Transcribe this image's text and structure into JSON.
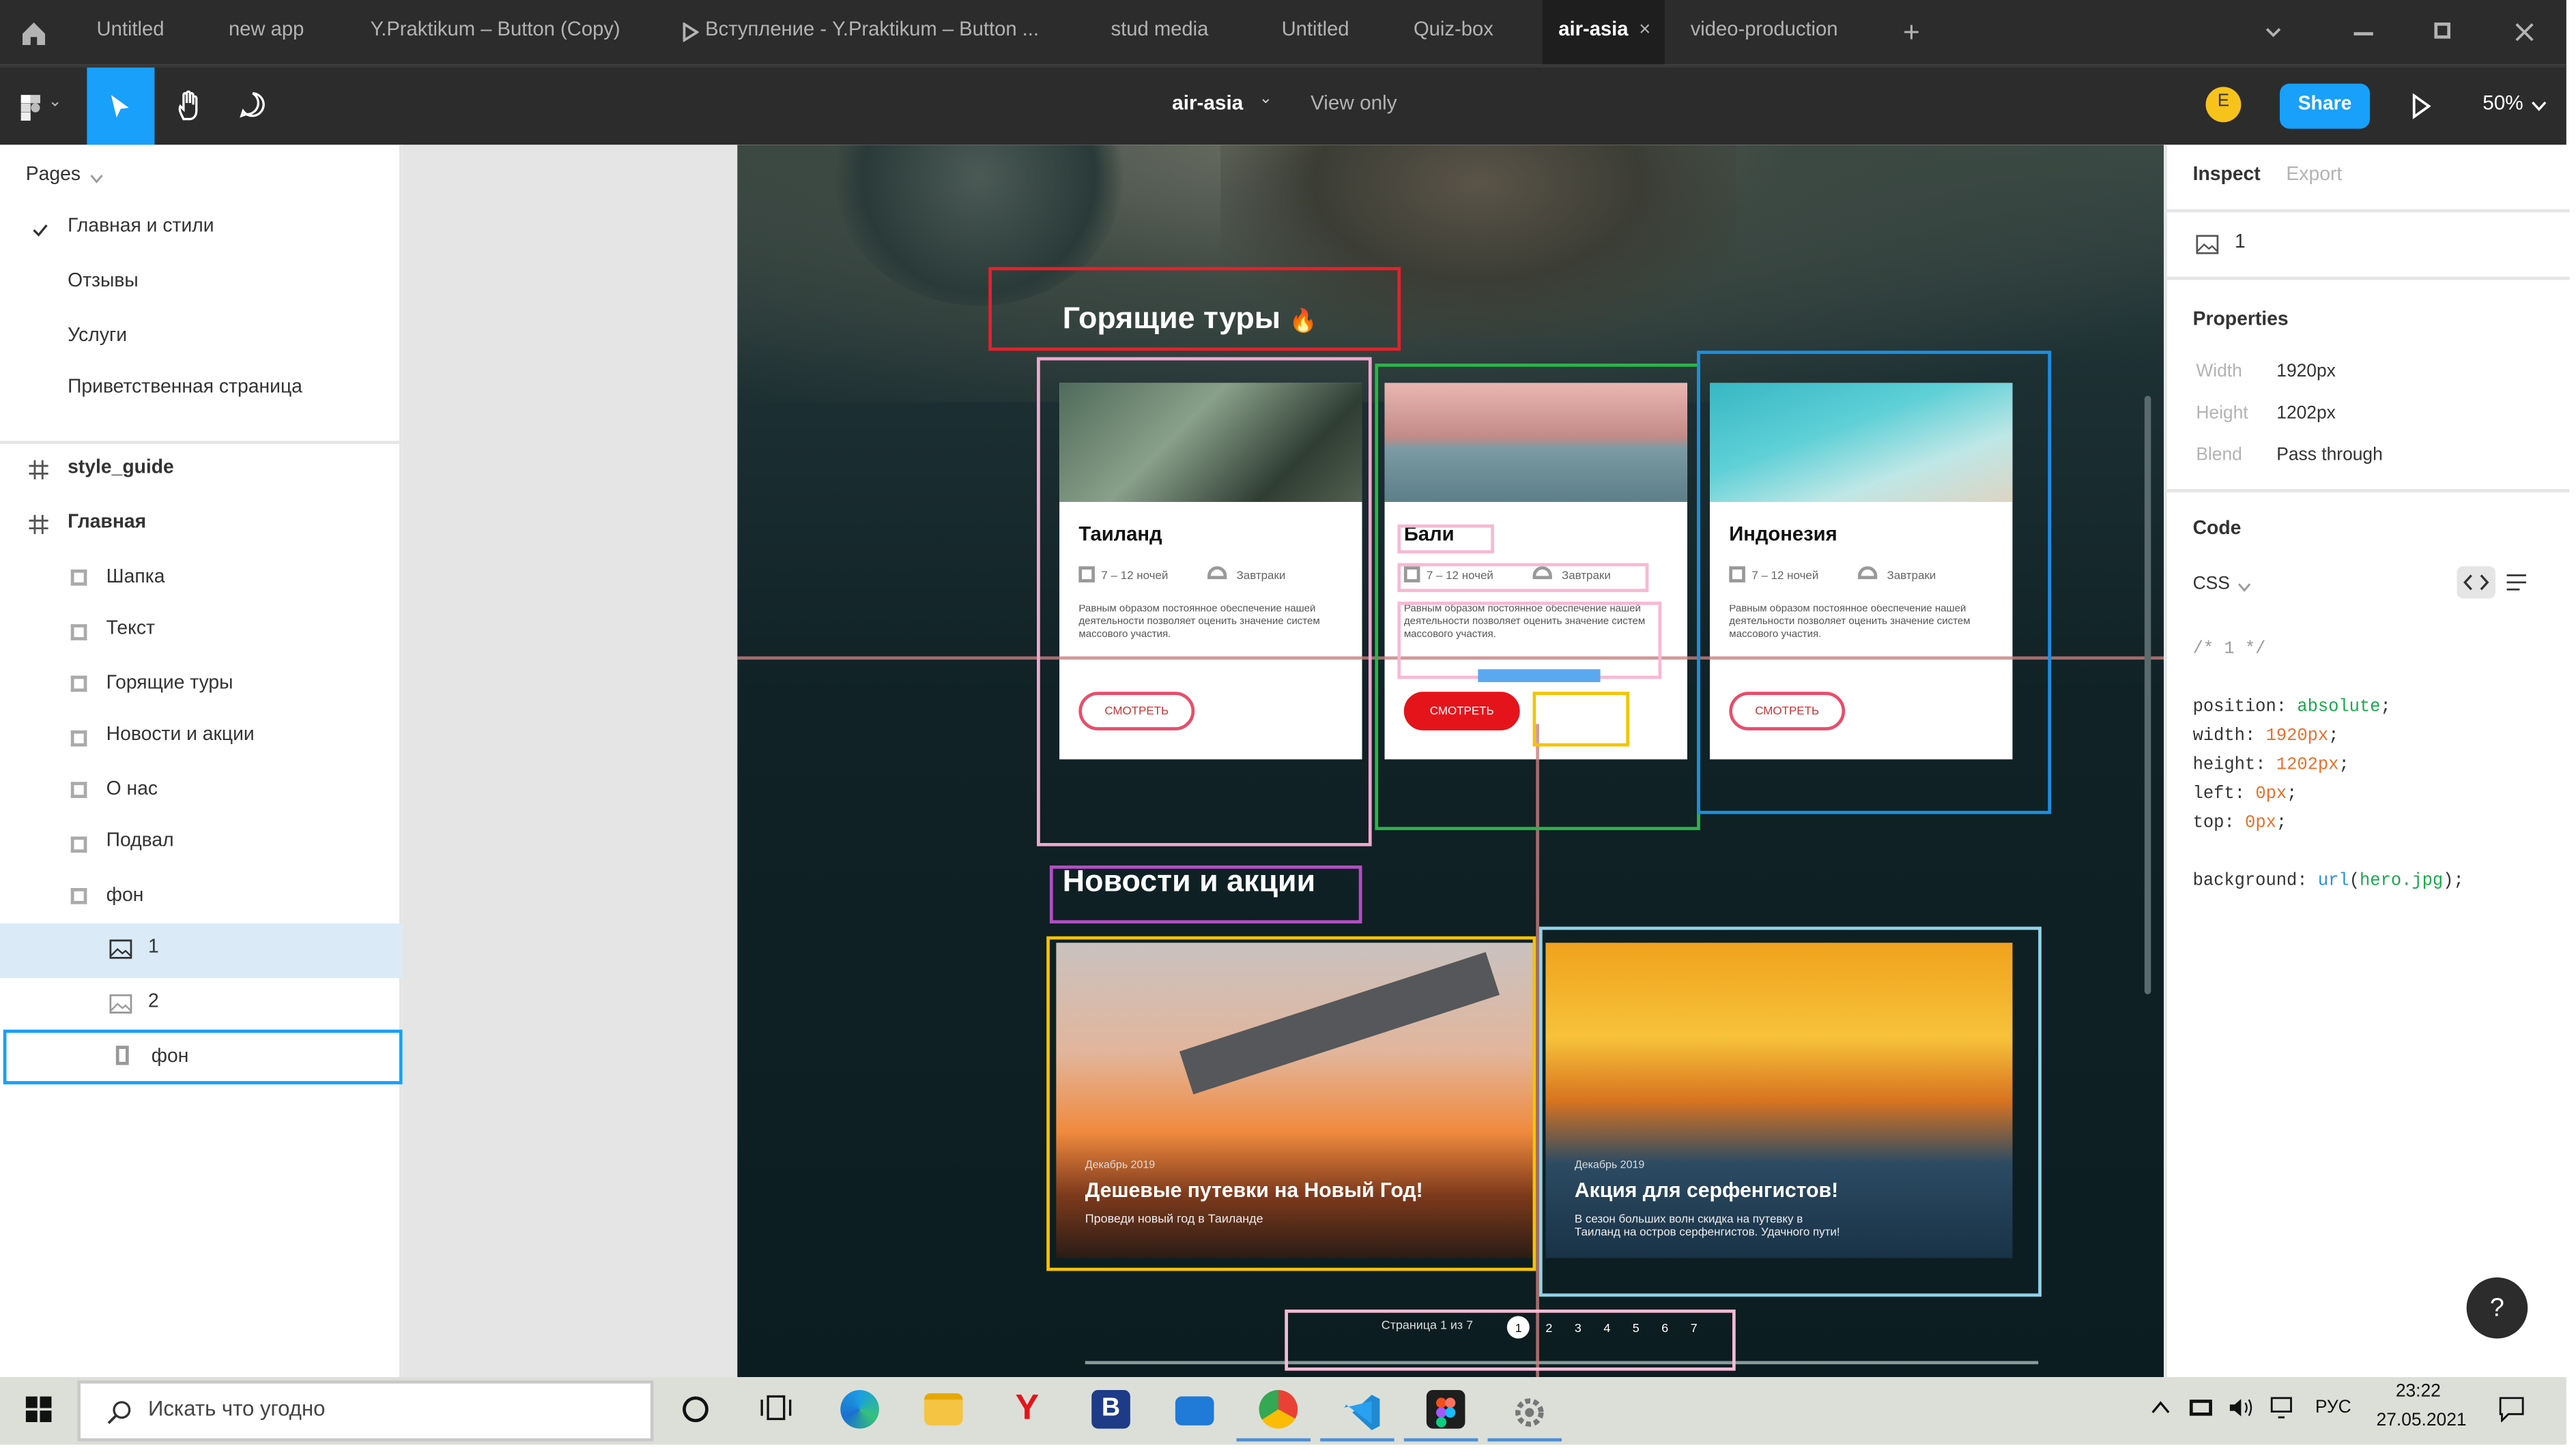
{
  "tabs": {
    "home_icon": "home-icon",
    "items": [
      {
        "label": "Untitled"
      },
      {
        "label": "new app"
      },
      {
        "label": "Y.Praktikum – Button (Copy)"
      },
      {
        "label": "Вступление - Y.Praktikum – Button ..."
      },
      {
        "label": "stud media"
      },
      {
        "label": "Untitled"
      },
      {
        "label": "Quiz-box"
      },
      {
        "label": "air-asia"
      },
      {
        "label": "video-production"
      }
    ],
    "active_index": 7,
    "close_symbol": "×",
    "add_symbol": "+"
  },
  "toolbar": {
    "file_name": "air-asia",
    "dropdown_caret": "⌄",
    "view_mode": "View only",
    "avatar_letter": "E",
    "share_label": "Share",
    "zoom_label": "50%",
    "colors": {
      "accent": "#18a0fb",
      "bg": "#2c2c2c",
      "avatar": "#f7c31b"
    }
  },
  "left_panel": {
    "pages_header": "Pages",
    "pages": [
      {
        "label": "Главная и стили",
        "checked": true
      },
      {
        "label": "Отзывы",
        "checked": false
      },
      {
        "label": "Услуги",
        "checked": false
      },
      {
        "label": "Приветственная страница",
        "checked": false
      }
    ],
    "layers": [
      {
        "label": "style_guide",
        "kind": "frame",
        "bold": true
      },
      {
        "label": "Главная",
        "kind": "frame",
        "bold": true
      },
      {
        "label": "Шапка",
        "kind": "group"
      },
      {
        "label": "Текст",
        "kind": "group"
      },
      {
        "label": "Горящие туры",
        "kind": "group"
      },
      {
        "label": "Новости и акции",
        "kind": "group"
      },
      {
        "label": "О нас",
        "kind": "group"
      },
      {
        "label": "Подвал",
        "kind": "group"
      },
      {
        "label": "фон",
        "kind": "group"
      },
      {
        "label": "1",
        "kind": "image",
        "selected": true
      },
      {
        "label": "2",
        "kind": "image"
      },
      {
        "label": "фон",
        "kind": "rect",
        "hovered": true
      }
    ]
  },
  "canvas": {
    "hot_tours_heading": "Горящие туры",
    "fire_emoji": "🔥",
    "cards": [
      {
        "title": "Таиланд",
        "nights": "7 – 12 ночей",
        "meals": "Завтраки",
        "desc": "Равным образом постоянное обеспечение нашей деятельности позволяет оценить значение систем массового участия.",
        "button": "СМОТРЕТЬ",
        "highlight_button": false
      },
      {
        "title": "Бали",
        "nights": "7 – 12 ночей",
        "meals": "Завтраки",
        "desc": "Равным образом постоянное обеспечение нашей деятельности позволяет оценить значение систем массового участия.",
        "button": "СМОТРЕТЬ",
        "highlight_button": true
      },
      {
        "title": "Индонезия",
        "nights": "7 – 12 ночей",
        "meals": "Завтраки",
        "desc": "Равным образом постоянное обеспечение нашей деятельности позволяет оценить значение систем массового участия.",
        "button": "СМОТРЕТЬ",
        "highlight_button": false
      }
    ],
    "news_heading": "Новости и акции",
    "news": [
      {
        "date": "Декабрь 2019",
        "title": "Дешевые путевки на Новый Год!",
        "subtitle": "Проведи новый год в Таиланде"
      },
      {
        "date": "Декабрь 2019",
        "title": "Акция для серфенгистов!",
        "subtitle": "В сезон больших волн скидка на путевку в Таиланд на остров серфенгистов. Удачного пути!"
      }
    ],
    "pagination": {
      "label": "Страница 1 из 7",
      "pages": [
        "1",
        "2",
        "3",
        "4",
        "5",
        "6",
        "7"
      ],
      "current": "1"
    },
    "highlight_colors": {
      "red": "#e8202a",
      "pink": "#f3a6cf",
      "green": "#2db34a",
      "blue": "#1b8fe0",
      "purple": "#b24fc3",
      "yellow": "#f5c400",
      "lightblue": "#8fd3e8",
      "lightpink": "#f7b9d3"
    }
  },
  "right_panel": {
    "tabs": [
      {
        "label": "Inspect",
        "active": true
      },
      {
        "label": "Export",
        "active": false
      }
    ],
    "layer_name": "1",
    "properties_header": "Properties",
    "properties": [
      {
        "label": "Width",
        "value": "1920px"
      },
      {
        "label": "Height",
        "value": "1202px"
      },
      {
        "label": "Blend",
        "value": "Pass through"
      }
    ],
    "code_header": "Code",
    "code_lang": "CSS",
    "code_comment": "/* 1 */",
    "code_lines": [
      {
        "prop": "position",
        "value": "absolute"
      },
      {
        "prop": "width",
        "value": "1920px"
      },
      {
        "prop": "height",
        "value": "1202px"
      },
      {
        "prop": "left",
        "value": "0px"
      },
      {
        "prop": "top",
        "value": "0px"
      }
    ],
    "background_line": {
      "prop": "background",
      "fn": "url",
      "arg": "hero.jpg"
    },
    "help_label": "?"
  },
  "taskbar": {
    "search_placeholder": "Искать что угодно",
    "lang": "РУС",
    "time": "23:22",
    "date": "27.05.2021",
    "apps": [
      "cortana-icon",
      "task-view-icon",
      "edge-icon",
      "explorer-icon",
      "yandex-icon",
      "b-app-icon",
      "mail-icon",
      "chrome-icon",
      "vscode-icon",
      "figma-icon",
      "settings-app-icon"
    ]
  }
}
